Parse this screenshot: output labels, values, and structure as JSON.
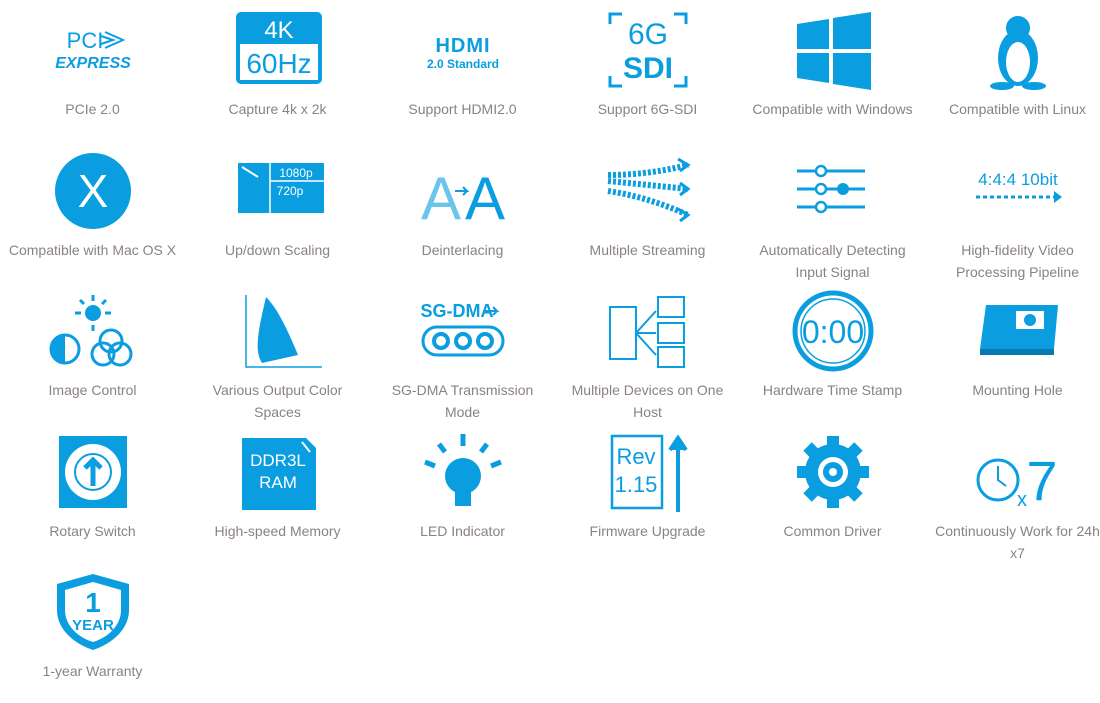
{
  "accent": "#0a9ee0",
  "text_color": "#8a8280",
  "features": [
    {
      "label": "PCIe 2.0",
      "icon": "pci-express-logo-icon",
      "glyph": [
        "PCI",
        "EXPRESS"
      ]
    },
    {
      "label": "Capture 4k x 2k",
      "icon": "4k-60hz-icon",
      "glyph": [
        "4K",
        "60Hz"
      ]
    },
    {
      "label": "Support HDMI2.0",
      "icon": "hdmi-logo-icon",
      "glyph": [
        "HDMI",
        "2.0 Standard"
      ]
    },
    {
      "label": "Support 6G-SDI",
      "icon": "6g-sdi-icon",
      "glyph": [
        "6G",
        "SDI"
      ]
    },
    {
      "label": "Compatible with Windows",
      "icon": "windows-logo-icon"
    },
    {
      "label": "Compatible with Linux",
      "icon": "linux-penguin-icon"
    },
    {
      "label": "Compatible with Mac OS X",
      "icon": "mac-os-x-icon",
      "glyph": [
        "X"
      ]
    },
    {
      "label": "Up/down Scaling",
      "icon": "scaling-icon",
      "glyph": [
        "1080p",
        "720p"
      ]
    },
    {
      "label": "Deinterlacing",
      "icon": "deinterlacing-icon",
      "glyph": [
        "A",
        "A"
      ]
    },
    {
      "label": "Multiple Streaming",
      "icon": "multiple-streaming-icon"
    },
    {
      "label": "Automatically Detecting Input Signal",
      "icon": "signal-detect-icon"
    },
    {
      "label": "High-fidelity Video Processing Pipeline",
      "icon": "pipeline-icon",
      "glyph": [
        "4:4:4 10bit"
      ]
    },
    {
      "label": "Image Control",
      "icon": "image-control-icon"
    },
    {
      "label": "Various Output Color Spaces",
      "icon": "color-space-icon"
    },
    {
      "label": "SG-DMA Transmission Mode",
      "icon": "sg-dma-icon",
      "glyph": [
        "SG-DMA"
      ]
    },
    {
      "label": "Multiple Devices on One Host",
      "icon": "multiple-devices-icon"
    },
    {
      "label": "Hardware Time Stamp",
      "icon": "time-stamp-icon",
      "glyph": [
        "0:00"
      ]
    },
    {
      "label": "Mounting Hole",
      "icon": "mounting-hole-icon"
    },
    {
      "label": "Rotary Switch",
      "icon": "rotary-switch-icon"
    },
    {
      "label": "High-speed Memory",
      "icon": "memory-icon",
      "glyph": [
        "DDR3L",
        "RAM"
      ]
    },
    {
      "label": "LED Indicator",
      "icon": "led-bulb-icon"
    },
    {
      "label": "Firmware Upgrade",
      "icon": "firmware-upgrade-icon",
      "glyph": [
        "Rev",
        "1.15"
      ]
    },
    {
      "label": "Common Driver",
      "icon": "gear-driver-icon"
    },
    {
      "label": "Continuously Work for 24h x7",
      "icon": "clock-24x7-icon",
      "glyph": [
        "x",
        "7"
      ]
    },
    {
      "label": "1-year Warranty",
      "icon": "warranty-shield-icon",
      "glyph": [
        "1",
        "YEAR"
      ]
    }
  ]
}
